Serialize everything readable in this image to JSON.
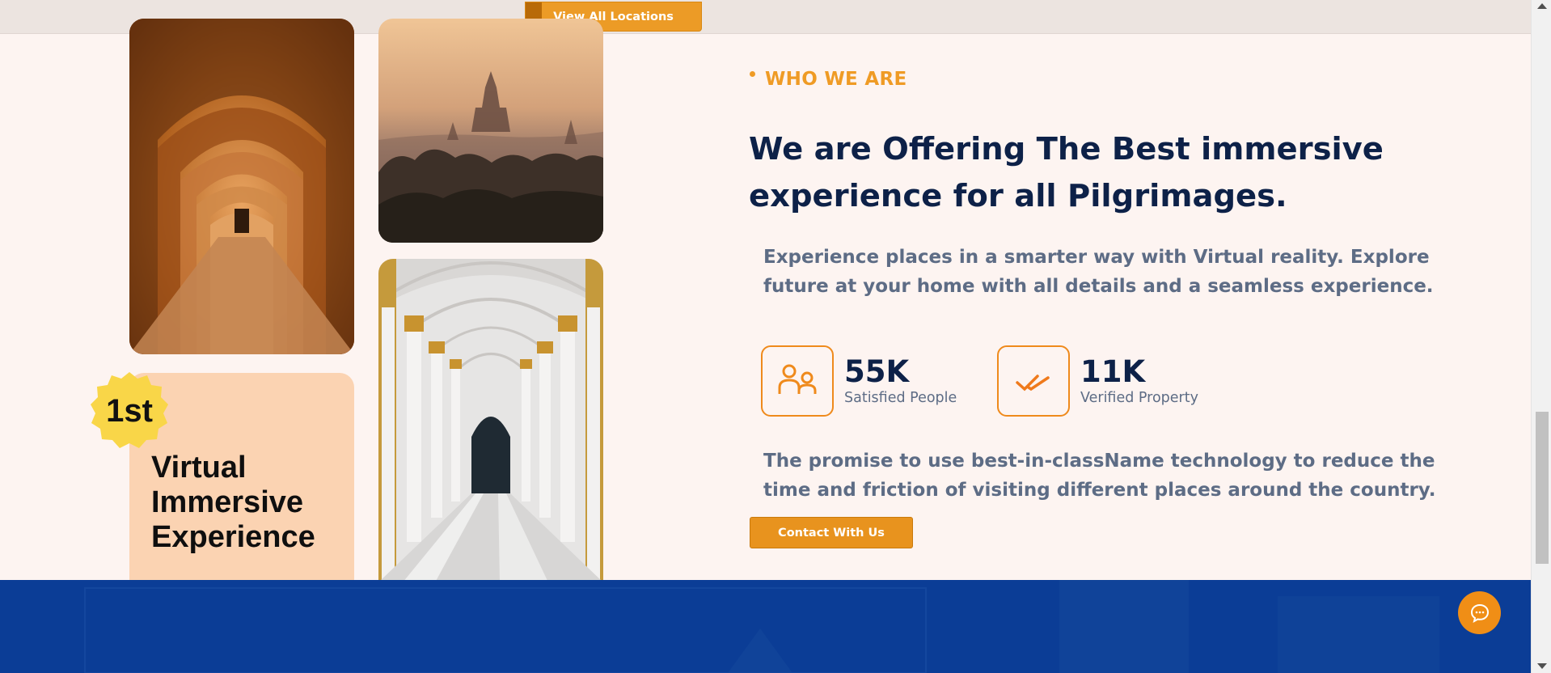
{
  "top": {
    "view_all_label": "View All Locations"
  },
  "badge": {
    "text": "1st"
  },
  "card": {
    "title": "Virtual Immersive Experience"
  },
  "about": {
    "eyebrow": "WHO WE ARE",
    "headline": "We are Offering The Best immersive experience for all Pilgrimages.",
    "paragraph1": "Experience places in a smarter way with Virtual reality. Explore future at your home with all details and a seamless experience.",
    "paragraph2": "The promise to use best-in-className technology to reduce the time and friction of visiting different places around the country.",
    "contact_label": "Contact With Us"
  },
  "stats": [
    {
      "value": "55K",
      "label": "Satisfied People",
      "icon": "people-icon"
    },
    {
      "value": "11K",
      "label": "Verified Property",
      "icon": "double-check-icon"
    }
  ],
  "colors": {
    "accent": "#ef9b25",
    "heading": "#0d2148",
    "body_text": "#5d6c85",
    "footer": "#0b3d96",
    "card": "#fbd3b2",
    "background": "#fdf4f1"
  }
}
